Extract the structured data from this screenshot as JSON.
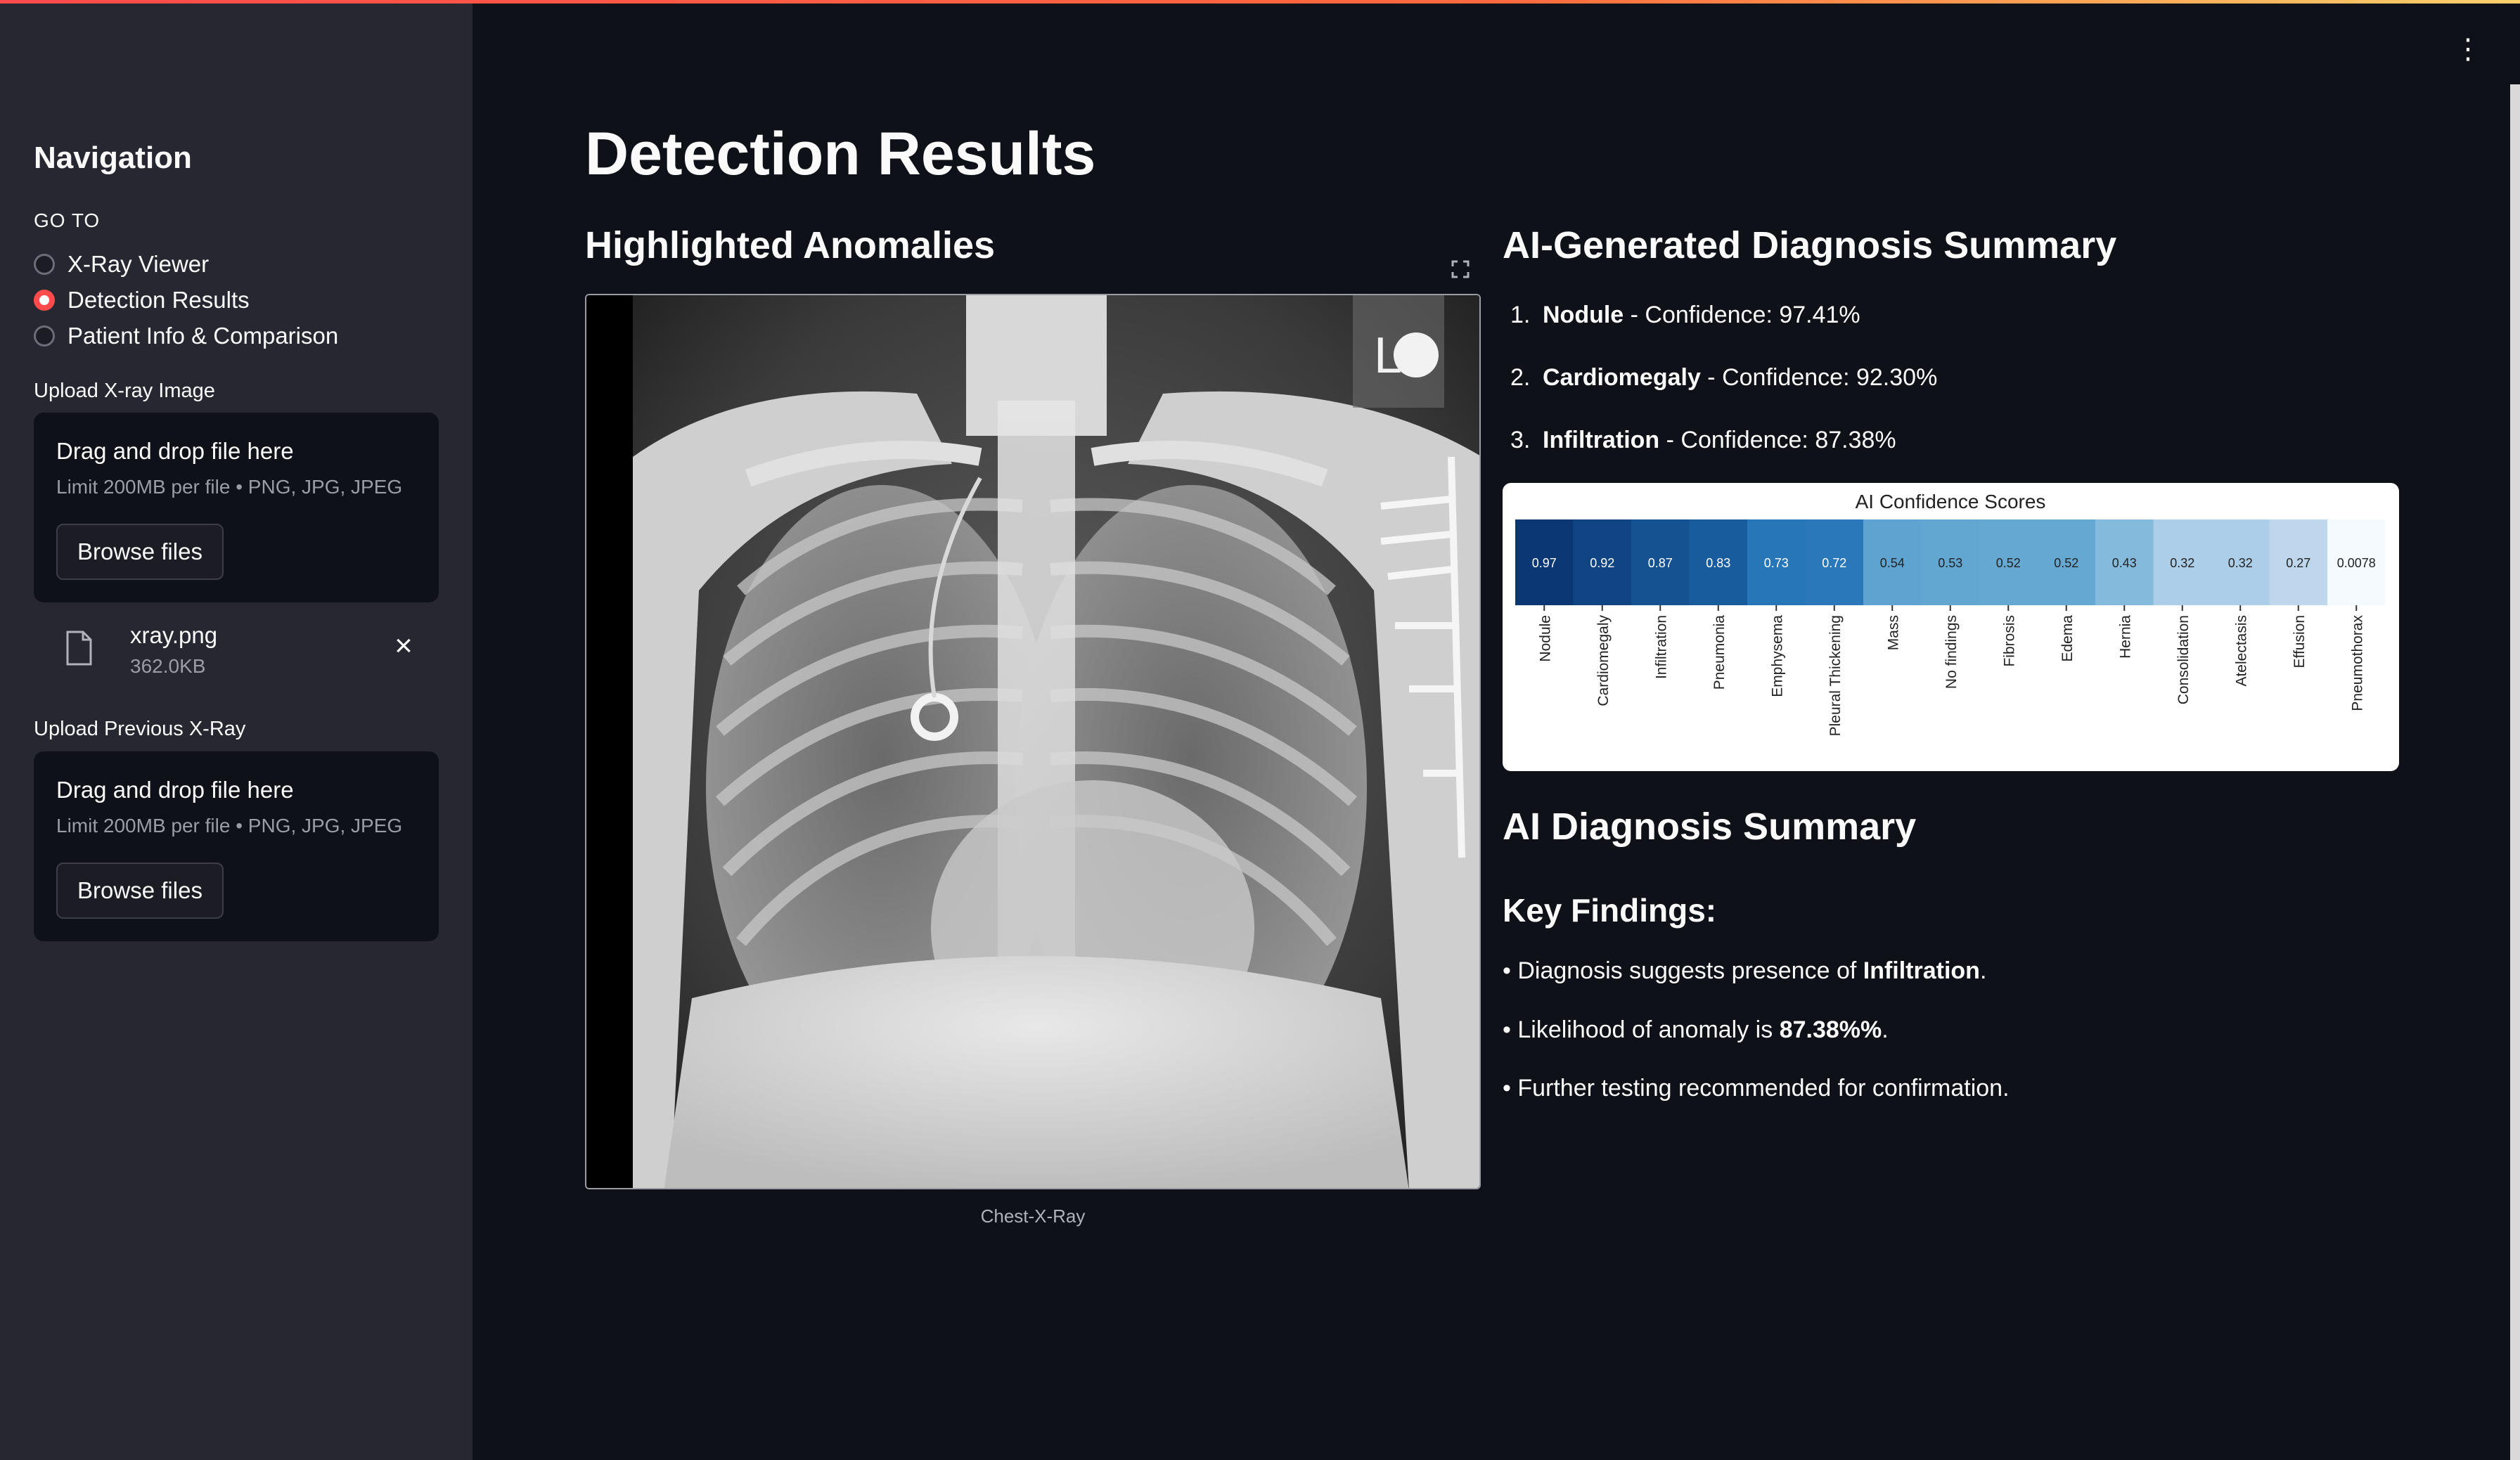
{
  "sidebar": {
    "title": "Navigation",
    "goto_label": "GO TO",
    "radio_options": [
      {
        "label": "X-Ray Viewer",
        "selected": false
      },
      {
        "label": "Detection Results",
        "selected": true
      },
      {
        "label": "Patient Info & Comparison",
        "selected": false
      }
    ],
    "upload_current": {
      "label": "Upload X-ray Image",
      "drop_text": "Drag and drop file here",
      "limit_text": "Limit 200MB per file • PNG, JPG, JPEG",
      "browse_label": "Browse files"
    },
    "uploaded_file": {
      "name": "xray.png",
      "size": "362.0KB"
    },
    "upload_previous": {
      "label": "Upload Previous X-Ray",
      "drop_text": "Drag and drop file here",
      "limit_text": "Limit 200MB per file • PNG, JPG, JPEG",
      "browse_label": "Browse files"
    }
  },
  "main": {
    "title": "Detection Results",
    "left_heading": "Highlighted Anomalies",
    "image_caption": "Chest-X-Ray",
    "image_marker": "L",
    "right_heading": "AI-Generated Diagnosis Summary",
    "findings": [
      {
        "index": "1.",
        "name": "Nodule",
        "sep": " - Confidence: ",
        "value": "97.41%"
      },
      {
        "index": "2.",
        "name": "Cardiomegaly",
        "sep": " - Confidence: ",
        "value": "92.30%"
      },
      {
        "index": "3.",
        "name": "Infiltration",
        "sep": " - Confidence: ",
        "value": "87.38%"
      }
    ],
    "summary_heading": "AI Diagnosis Summary",
    "key_findings_heading": "Key Findings:",
    "summary_lines": [
      {
        "prefix": "• Diagnosis suggests presence of ",
        "bold": "Infiltration",
        "suffix": "."
      },
      {
        "prefix": "• Likelihood of anomaly is ",
        "bold": "87.38%%",
        "suffix": "."
      },
      {
        "prefix": "• Further testing recommended for confirmation.",
        "bold": "",
        "suffix": ""
      }
    ]
  },
  "chart_data": {
    "type": "heatmap",
    "title": "AI Confidence Scores",
    "categories": [
      "Nodule",
      "Cardiomegaly",
      "Infiltration",
      "Pneumonia",
      "Emphysema",
      "Pleural Thickening",
      "Mass",
      "No findings",
      "Fibrosis",
      "Edema",
      "Hernia",
      "Consolidation",
      "Atelectasis",
      "Effusion",
      "Pneumothorax"
    ],
    "values": [
      0.97,
      0.92,
      0.87,
      0.83,
      0.73,
      0.72,
      0.54,
      0.53,
      0.52,
      0.52,
      0.43,
      0.32,
      0.32,
      0.27,
      0.0078
    ],
    "value_labels": [
      "0.97",
      "0.92",
      "0.87",
      "0.83",
      "0.73",
      "0.72",
      "0.54",
      "0.53",
      "0.52",
      "0.52",
      "0.43",
      "0.32",
      "0.32",
      "0.27",
      "0.0078"
    ],
    "colormap": "Blues"
  }
}
